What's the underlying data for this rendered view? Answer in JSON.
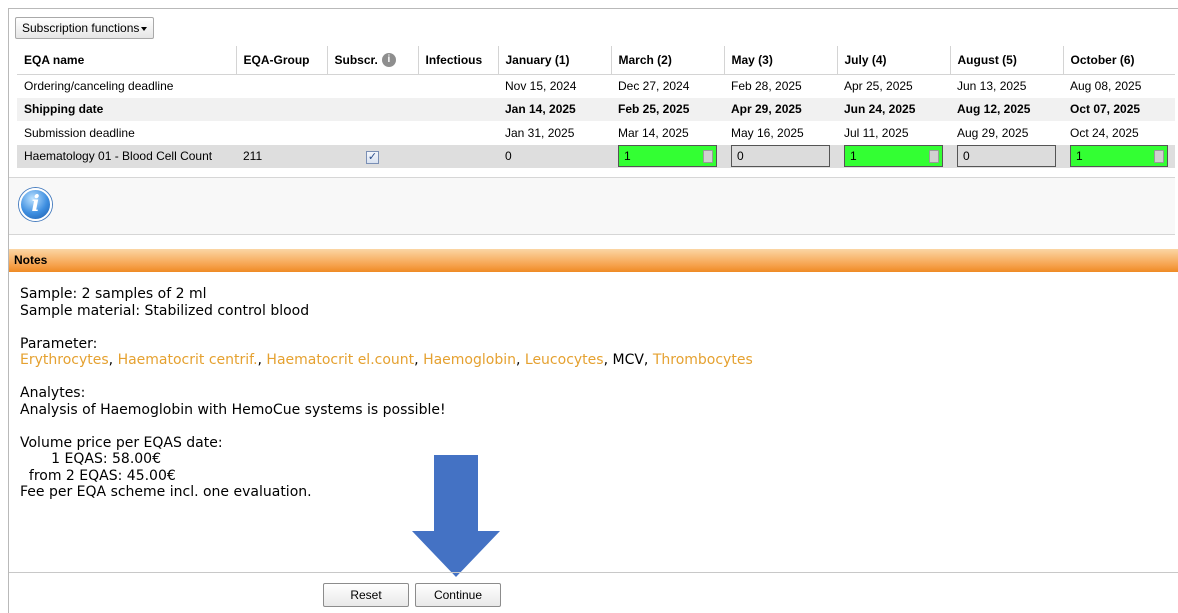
{
  "toolbar": {
    "subscription_functions": "Subscription functions"
  },
  "table": {
    "headers": [
      "EQA name",
      "EQA-Group",
      "Subscr.",
      "Infectious",
      "January (1)",
      "March (2)",
      "May (3)",
      "July (4)",
      "August (5)",
      "October (6)"
    ],
    "rows": [
      {
        "name": "Ordering/canceling deadline",
        "group": "",
        "dates": [
          "Nov 15, 2024",
          "Dec 27, 2024",
          "Feb 28, 2025",
          "Apr 25, 2025",
          "Jun 13, 2025",
          "Aug 08, 2025"
        ]
      },
      {
        "name": "Shipping date",
        "group": "",
        "dates": [
          "Jan 14, 2025",
          "Feb 25, 2025",
          "Apr 29, 2025",
          "Jun 24, 2025",
          "Aug 12, 2025",
          "Oct 07, 2025"
        ]
      },
      {
        "name": "Submission deadline",
        "group": "",
        "dates": [
          "Jan 31, 2025",
          "Mar 14, 2025",
          "May 16, 2025",
          "Jul 11, 2025",
          "Aug 29, 2025",
          "Oct 24, 2025"
        ]
      }
    ],
    "scheme": {
      "name": "Haematology 01 - Blood Cell Count",
      "group": "211",
      "subscribed": true,
      "january": "0",
      "quantities": [
        "1",
        "0",
        "1",
        "0",
        "1"
      ],
      "states": [
        "green",
        "grey",
        "green",
        "grey",
        "green"
      ]
    }
  },
  "notes": {
    "title": "Notes",
    "sample": "Sample: 2 samples of 2 ml",
    "material": "Sample material: Stabilized control blood",
    "parameter_label": "Parameter:",
    "parameters": [
      {
        "text": "Erythrocytes",
        "link": true
      },
      {
        "text": "Haematocrit centrif.",
        "link": true
      },
      {
        "text": "Haematocrit el.count",
        "link": true
      },
      {
        "text": "Haemoglobin",
        "link": true
      },
      {
        "text": "Leucocytes",
        "link": true
      },
      {
        "text": "MCV",
        "link": false
      },
      {
        "text": "Thrombocytes",
        "link": true
      }
    ],
    "analytes_label": "Analytes:",
    "analytes_text": "Analysis of Haemoglobin with HemoCue systems is possible!",
    "volume_label": "Volume price per EQAS date:",
    "price_1": "       1 EQAS: 58.00€",
    "price_2": "  from 2 EQAS: 45.00€",
    "fee": "Fee per EQA scheme incl. one evaluation."
  },
  "buttons": {
    "reset": "Reset",
    "continue": "Continue"
  },
  "colors": {
    "accent_green": "#33ff33",
    "notes_orange": "#f6a24d",
    "link_orange": "#e5a130",
    "arrow_blue": "#4472c4"
  }
}
